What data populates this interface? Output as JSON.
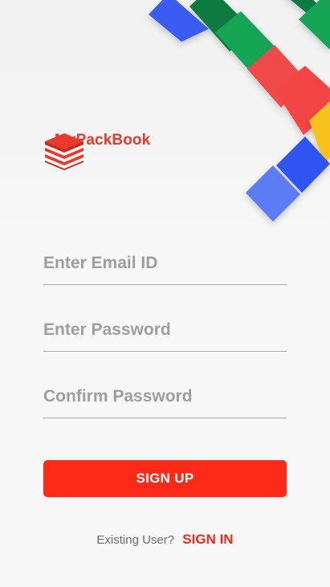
{
  "brand": {
    "name": "MyPackBook",
    "color": "#e53a2c",
    "icon": "stacked-books-icon"
  },
  "form": {
    "email_placeholder": "Enter Email ID",
    "password_placeholder": "Enter Password",
    "confirm_placeholder": "Confirm Password"
  },
  "actions": {
    "signup_label": "SIGN UP",
    "signup_color": "#fc2a16",
    "existing_text": "Existing User?",
    "signin_label": "SIGN IN"
  },
  "palette": {
    "blue": "#3b5cf0",
    "green": "#0f9d58",
    "red": "#ef4a4a",
    "yellow": "#f7c21b"
  }
}
